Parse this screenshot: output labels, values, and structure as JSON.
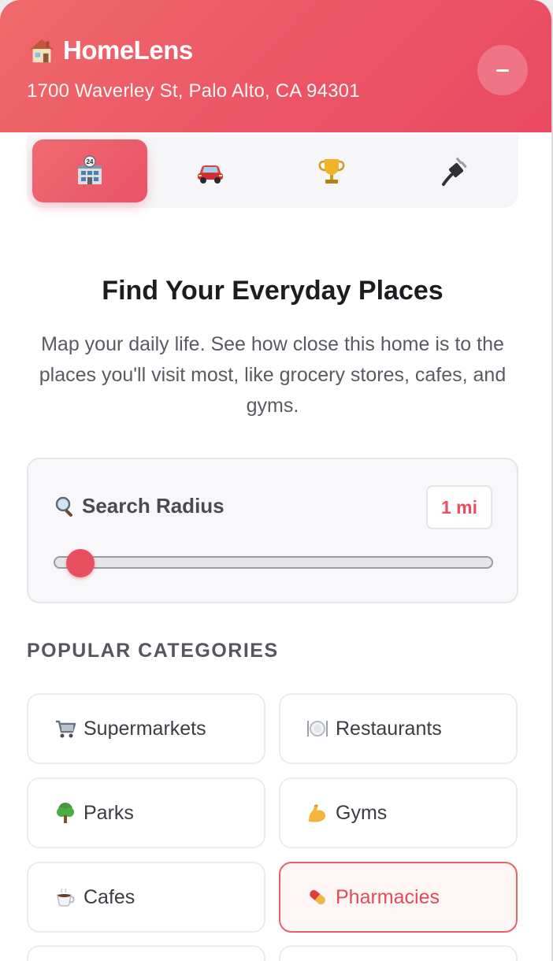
{
  "header": {
    "app_name": "HomeLens",
    "address": "1700 Waverley St, Palo Alto, CA 94301",
    "brand_icon": "house-icon",
    "minimize_icon": "minus-icon"
  },
  "tabs": [
    {
      "icon": "24-hour-store-icon",
      "active": true
    },
    {
      "icon": "car-icon",
      "active": false
    },
    {
      "icon": "trophy-icon",
      "active": false
    },
    {
      "icon": "electric-plug-icon",
      "active": false
    }
  ],
  "main": {
    "title": "Find Your Everyday Places",
    "description": "Map your daily life. See how close this home is to the places you'll visit most, like grocery stores, cafes, and gyms."
  },
  "radius": {
    "label": "Search Radius",
    "value": "1 mi",
    "icon": "magnifying-glass-icon",
    "slider_fraction": 0.0
  },
  "categories": {
    "title": "POPULAR CATEGORIES",
    "items": [
      {
        "label": "Supermarkets",
        "icon": "shopping-cart-icon",
        "selected": false
      },
      {
        "label": "Restaurants",
        "icon": "plate-cutlery-icon",
        "selected": false
      },
      {
        "label": "Parks",
        "icon": "tree-icon",
        "selected": false
      },
      {
        "label": "Gyms",
        "icon": "flexed-biceps-icon",
        "selected": false
      },
      {
        "label": "Cafes",
        "icon": "coffee-icon",
        "selected": false
      },
      {
        "label": "Pharmacies",
        "icon": "pill-icon",
        "selected": true
      }
    ]
  },
  "colors": {
    "accent": "#e9505f",
    "header_gradient_start": "#ef6a6a",
    "header_gradient_end": "#ea4a62"
  }
}
